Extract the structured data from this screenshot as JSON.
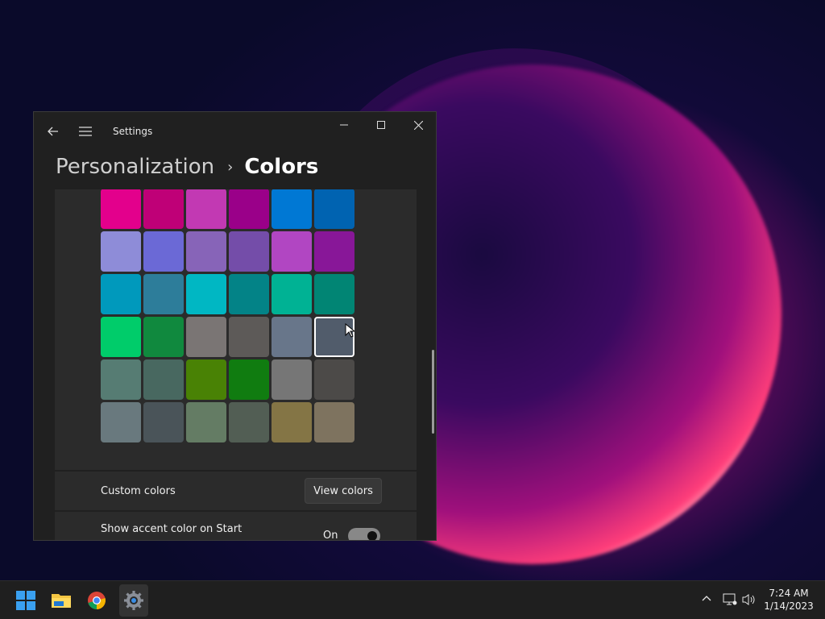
{
  "window": {
    "app_title": "Settings",
    "breadcrumb": {
      "parent": "Personalization",
      "separator": "›",
      "current": "Colors"
    }
  },
  "accent_colors": {
    "rows": [
      [
        "#d13438",
        "#e0443e",
        "#e74856",
        "#e81123",
        "#ea005e",
        "#c30052"
      ],
      [
        "#e3008c",
        "#bf0077",
        "#c239b3",
        "#9a0089",
        "#0078d4",
        "#0063b1"
      ],
      [
        "#8e8cd8",
        "#6b69d6",
        "#8764b8",
        "#744da9",
        "#b146c2",
        "#881798"
      ],
      [
        "#0099bc",
        "#2d7d9a",
        "#00b7c3",
        "#038387",
        "#00b294",
        "#018574"
      ],
      [
        "#00cc6a",
        "#10893e",
        "#7a7574",
        "#5d5a58",
        "#68768a",
        "#515c6b"
      ],
      [
        "#567c73",
        "#486860",
        "#498205",
        "#107c10",
        "#767676",
        "#4c4a48"
      ],
      [
        "#69797e",
        "#4a5459",
        "#647c64",
        "#525e54",
        "#847545",
        "#7e735f"
      ]
    ],
    "selected": [
      4,
      5
    ]
  },
  "custom_colors": {
    "label": "Custom colors",
    "button": "View colors"
  },
  "show_accent": {
    "label": "Show accent color on Start",
    "state": "On"
  },
  "taskbar": {
    "time": "7:24 AM",
    "date": "1/14/2023"
  }
}
